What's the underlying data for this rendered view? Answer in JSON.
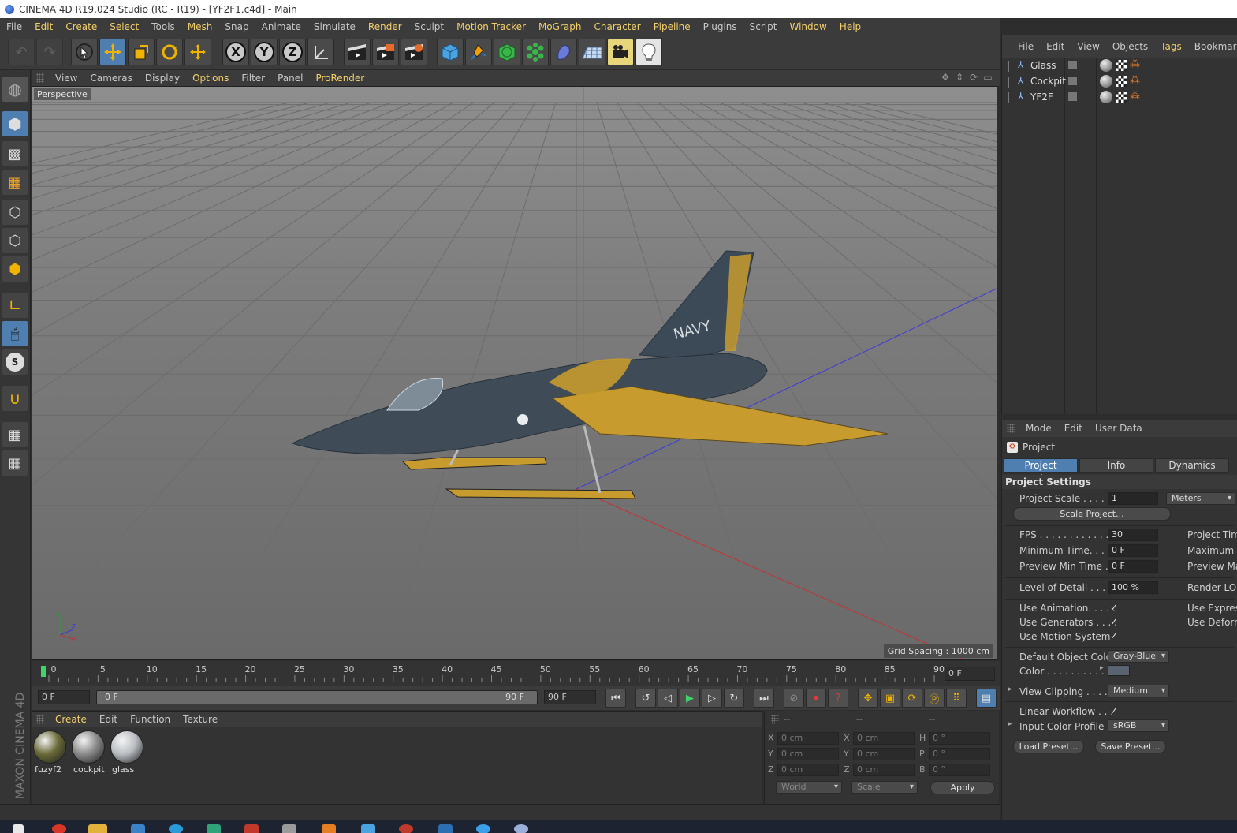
{
  "window": {
    "title": "CINEMA 4D R19.024 Studio (RC - R19) - [YF2F1.c4d] - Main"
  },
  "menubar": {
    "items": [
      {
        "label": "File",
        "hl": false
      },
      {
        "label": "Edit",
        "hl": true
      },
      {
        "label": "Create",
        "hl": true
      },
      {
        "label": "Select",
        "hl": true
      },
      {
        "label": "Tools",
        "hl": false
      },
      {
        "label": "Mesh",
        "hl": true
      },
      {
        "label": "Snap",
        "hl": false
      },
      {
        "label": "Animate",
        "hl": false
      },
      {
        "label": "Simulate",
        "hl": false
      },
      {
        "label": "Render",
        "hl": true
      },
      {
        "label": "Sculpt",
        "hl": false
      },
      {
        "label": "Motion Tracker",
        "hl": true
      },
      {
        "label": "MoGraph",
        "hl": true
      },
      {
        "label": "Character",
        "hl": true
      },
      {
        "label": "Pipeline",
        "hl": true
      },
      {
        "label": "Plugins",
        "hl": false
      },
      {
        "label": "Script",
        "hl": false
      },
      {
        "label": "Window",
        "hl": true
      },
      {
        "label": "Help",
        "hl": true
      }
    ]
  },
  "toolbar": {
    "axis_x": "X",
    "axis_y": "Y",
    "axis_z": "Z"
  },
  "viewport": {
    "menu": [
      {
        "label": "View",
        "hl": false
      },
      {
        "label": "Cameras",
        "hl": false
      },
      {
        "label": "Display",
        "hl": false
      },
      {
        "label": "Options",
        "hl": true
      },
      {
        "label": "Filter",
        "hl": false
      },
      {
        "label": "Panel",
        "hl": false
      },
      {
        "label": "ProRender",
        "hl": true
      }
    ],
    "camera": "Perspective",
    "grid_spacing": "Grid Spacing : 1000 cm",
    "aircraft_text": "NAVY",
    "axis_y": "y",
    "axis_z": "z",
    "axis_x": "x"
  },
  "timeline": {
    "ticks": [
      "0",
      "5",
      "10",
      "15",
      "20",
      "25",
      "30",
      "35",
      "40",
      "45",
      "50",
      "55",
      "60",
      "65",
      "70",
      "75",
      "80",
      "85",
      "90"
    ],
    "current_frame": "0 F",
    "start": "0 F",
    "range_start": "0 F",
    "range_end": "90 F",
    "end": "90 F"
  },
  "material_manager": {
    "menu": [
      {
        "label": "Create",
        "hl": true
      },
      {
        "label": "Edit",
        "hl": false
      },
      {
        "label": "Function",
        "hl": false
      },
      {
        "label": "Texture",
        "hl": false
      }
    ],
    "materials": [
      {
        "name": "fuzyf2",
        "color": "#6b6a3a"
      },
      {
        "name": "cockpit",
        "color": "#8a8a8a"
      },
      {
        "name": "glass",
        "color": "#b9bdc2"
      }
    ]
  },
  "coordinates": {
    "headers": [
      "--",
      "--",
      "--"
    ],
    "rows": [
      {
        "l1": "X",
        "v1": "0 cm",
        "l2": "X",
        "v2": "0 cm",
        "l3": "H",
        "v3": "0 °"
      },
      {
        "l1": "Y",
        "v1": "0 cm",
        "l2": "Y",
        "v2": "0 cm",
        "l3": "P",
        "v3": "0 °"
      },
      {
        "l1": "Z",
        "v1": "0 cm",
        "l2": "Z",
        "v2": "0 cm",
        "l3": "B",
        "v3": "0 °"
      }
    ],
    "mode": "World",
    "scale": "Scale",
    "apply": "Apply"
  },
  "object_manager": {
    "menu": [
      {
        "label": "File",
        "hl": false
      },
      {
        "label": "Edit",
        "hl": false
      },
      {
        "label": "View",
        "hl": false
      },
      {
        "label": "Objects",
        "hl": false
      },
      {
        "label": "Tags",
        "hl": true
      },
      {
        "label": "Bookmarks",
        "hl": false
      }
    ],
    "objects": [
      {
        "name": "Glass"
      },
      {
        "name": "Cockpit"
      },
      {
        "name": "YF2F"
      }
    ]
  },
  "attribute_manager": {
    "menu": [
      "Mode",
      "Edit",
      "User Data"
    ],
    "object": "Project",
    "tabs": [
      "Project Settings",
      "Info",
      "Dynamics"
    ],
    "section": "Project Settings",
    "project_scale_label": "Project Scale . . . . . .",
    "project_scale_value": "1",
    "project_scale_unit": "Meters",
    "scale_project_btn": "Scale Project...",
    "fps_label": "FPS . . . . . . . . . . . . . .",
    "fps_value": "30",
    "min_time_label": "Minimum Time. . . . .",
    "min_time_value": "0 F",
    "preview_min_label": "Preview Min Time . .",
    "preview_min_value": "0 F",
    "project_time_label": "Project Time",
    "max_time_label": "Maximum Ti",
    "preview_max_label": "Preview Max",
    "lod_label": "Level of Detail . . . . .",
    "lod_value": "100 %",
    "render_lod_label": "Render LOD",
    "use_animation_label": "Use Animation. . . . .",
    "use_generators_label": "Use Generators . . . .",
    "use_motion_label": "Use Motion System",
    "use_express_label": "Use Expressi",
    "use_deform_label": "Use Deforme",
    "check_mark": "✓",
    "default_color_label": "Default Object Color",
    "default_color_value": "Gray-Blue",
    "color_label": "Color . . . . . . . . . .",
    "color_swatch": "#5a6470",
    "view_clipping_label": "View Clipping . . . . .",
    "view_clipping_value": "Medium",
    "linear_workflow_label": "Linear Workflow . . .",
    "input_profile_label": "Input Color Profile . .",
    "input_profile_value": "sRGB",
    "load_preset": "Load Preset...",
    "save_preset": "Save Preset..."
  }
}
